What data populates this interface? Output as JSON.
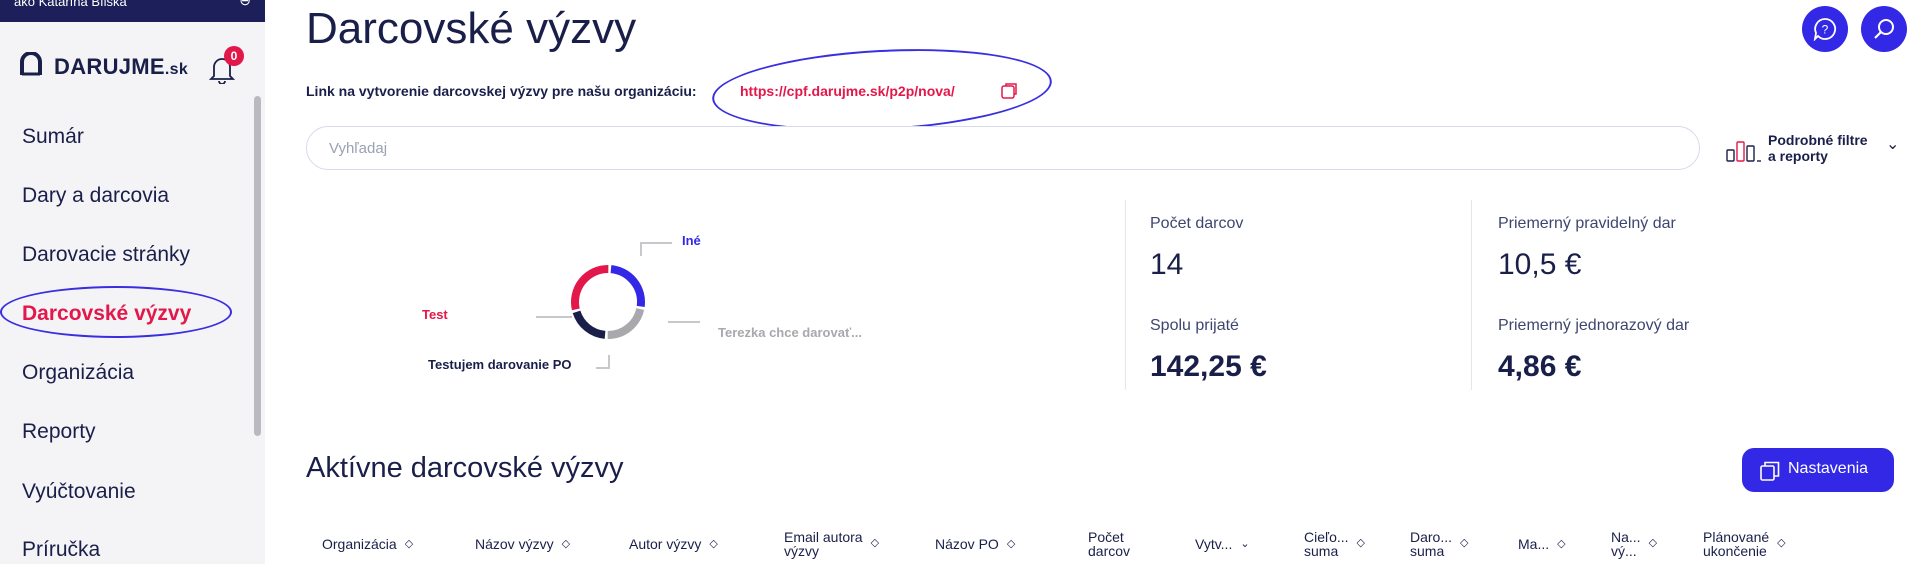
{
  "sidebar": {
    "impersonation_text": "ako Katarína Bílska",
    "logo_text": "DARUJME",
    "logo_tld": ".sk",
    "notification_count": "0",
    "items": [
      {
        "label": "Sumár",
        "active": false
      },
      {
        "label": "Dary a darcovia",
        "active": false
      },
      {
        "label": "Darovacie stránky",
        "active": false
      },
      {
        "label": "Darcovské výzvy",
        "active": true
      },
      {
        "label": "Organizácia",
        "active": false
      },
      {
        "label": "Reporty",
        "active": false
      },
      {
        "label": "Vyúčtovanie",
        "active": false
      },
      {
        "label": "Príručka",
        "active": false
      }
    ]
  },
  "header": {
    "title": "Darcovské výzvy",
    "link_label": "Link na vytvorenie darcovskej výzvy pre našu organizáciu:",
    "link_url": "https://cpf.darujme.sk/p2p/nova/"
  },
  "search": {
    "placeholder": "Vyhľadaj"
  },
  "filters": {
    "label_line1": "Podrobné filtre",
    "label_line2": "a reporty"
  },
  "donut": {
    "segments": [
      {
        "name": "Iné",
        "color": "#3328e6",
        "fraction": 0.27
      },
      {
        "name": "Terezka chce darovať...",
        "color": "#a8a8ad",
        "fraction": 0.23
      },
      {
        "name": "Testujem darovanie PO",
        "color": "#1a1f4a",
        "fraction": 0.2
      },
      {
        "name": "Test",
        "color": "#e3184a",
        "fraction": 0.3
      }
    ]
  },
  "stats": {
    "donors_label": "Počet darcov",
    "donors_value": "14",
    "avg_regular_label": "Priemerný pravidelný dar",
    "avg_regular_value": "10,5 €",
    "total_label": "Spolu prijaté",
    "total_value": "142,25 €",
    "avg_single_label": "Priemerný jednorazový dar",
    "avg_single_value": "4,86 €"
  },
  "section": {
    "title": "Aktívne darcovské výzvy",
    "settings_label": "Nastavenia"
  },
  "table": {
    "columns": [
      {
        "line1": "Organizácia",
        "line2": "",
        "sort": "◇"
      },
      {
        "line1": "Názov výzvy",
        "line2": "",
        "sort": "◇"
      },
      {
        "line1": "Autor výzvy",
        "line2": "",
        "sort": "◇"
      },
      {
        "line1": "Email autora",
        "line2": "výzvy",
        "sort": "◇"
      },
      {
        "line1": "Názov PO",
        "line2": "",
        "sort": "◇"
      },
      {
        "line1": "Počet",
        "line2": "darcov",
        "sort": ""
      },
      {
        "line1": "Vytv...",
        "line2": "",
        "sort": "⌄"
      },
      {
        "line1": "Cieľo...",
        "line2": "suma",
        "sort": "◇"
      },
      {
        "line1": "Daro...",
        "line2": "suma",
        "sort": "◇"
      },
      {
        "line1": "Ma...",
        "line2": "",
        "sort": "◇"
      },
      {
        "line1": "Na...",
        "line2": "vý...",
        "sort": "◇"
      },
      {
        "line1": "Plánované",
        "line2": "ukončenie",
        "sort": "◇"
      }
    ]
  },
  "colors": {
    "brand_navy": "#1a1f4a",
    "accent_blue": "#3328e6",
    "accent_red": "#e3184a",
    "annotation_blue": "#3a2fe0"
  }
}
